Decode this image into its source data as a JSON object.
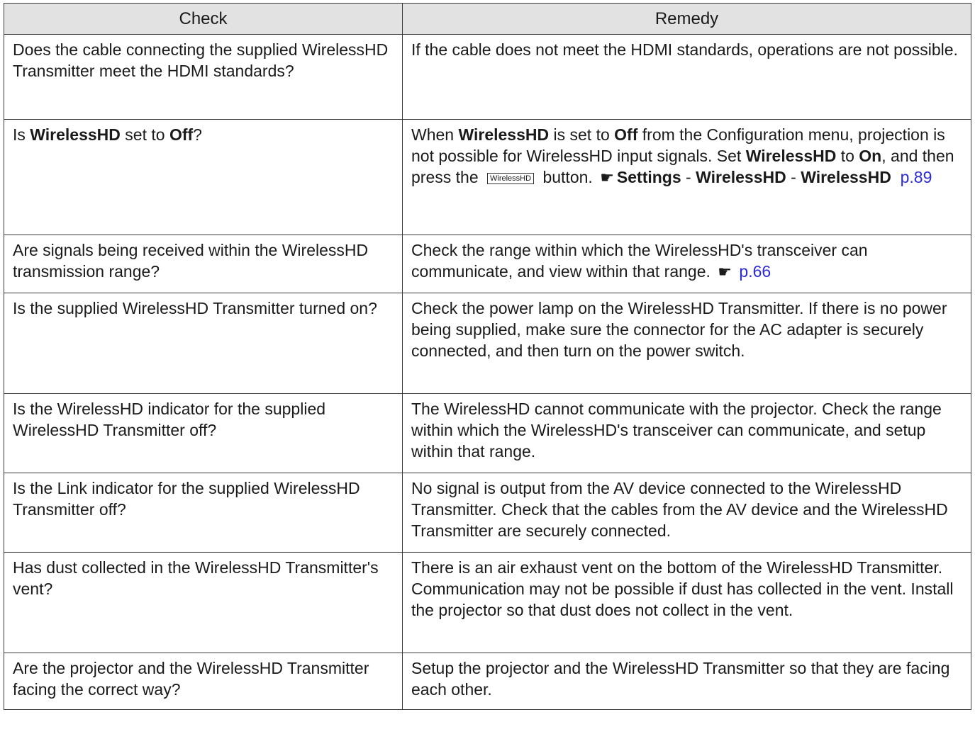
{
  "header": {
    "check": "Check",
    "remedy": "Remedy"
  },
  "rows": [
    {
      "check": "Does the cable connecting the supplied WirelessHD Transmitter meet the HDMI standards?",
      "remedy": "If the cable does not meet the HDMI standards, operations are not possible."
    },
    {
      "check_pre": "Is ",
      "check_b1": "WirelessHD",
      "check_mid": " set to ",
      "check_b2": "Off",
      "check_post": "?",
      "r_pre": "When ",
      "r_b1": "WirelessHD",
      "r_mid1": " is set to ",
      "r_b2": "Off",
      "r_mid2": " from the Configuration menu, projection is not possible for WirelessHD input signals. Set ",
      "r_b3": "WirelessHD",
      "r_mid3": " to ",
      "r_b4": "On",
      "r_mid4": ", and then press the ",
      "r_button": "WirelessHD",
      "r_mid5": " button. ",
      "r_b5": "Settings",
      "r_sep1": " - ",
      "r_b6": "WirelessHD",
      "r_sep2": " - ",
      "r_b7": "WirelessHD",
      "r_link": "p.89"
    },
    {
      "check": "Are signals being received within the WirelessHD transmission range?",
      "remedy": "Check the range within which the WirelessHD's transceiver can communicate, and view within that range.",
      "link": "p.66"
    },
    {
      "check": "Is the supplied WirelessHD Transmitter turned on?",
      "remedy": "Check the power lamp on the WirelessHD Transmitter. If there is no power being supplied, make sure the connector for the AC adapter is securely connected, and then turn on the power switch."
    },
    {
      "check": "Is the WirelessHD indicator for the supplied WirelessHD Transmitter off?",
      "remedy": "The WirelessHD cannot communicate with the projector. Check the range within which the WirelessHD's transceiver can communicate, and setup within that range."
    },
    {
      "check": "Is the Link indicator for the supplied WirelessHD Transmitter off?",
      "remedy": "No signal is output from the AV device connected to the WirelessHD Transmitter. Check that the cables from the AV device and the WirelessHD Transmitter are securely connected."
    },
    {
      "check": "Has dust collected in the WirelessHD Transmitter's vent?",
      "remedy": "There is an air exhaust vent on the bottom of the WirelessHD Transmitter. Communication may not be possible if dust has collected in the vent. Install the projector so that dust does not collect in the vent."
    },
    {
      "check": "Are the projector and the WirelessHD Transmitter facing the correct way?",
      "remedy": "Setup the projector and the WirelessHD Transmitter so that they are facing each other."
    }
  ],
  "icons": {
    "reference": "pointing-hand-icon"
  },
  "colors": {
    "header_bg": "#e2e2e2",
    "link": "#2b2bd8",
    "border": "#3a3a3a"
  }
}
